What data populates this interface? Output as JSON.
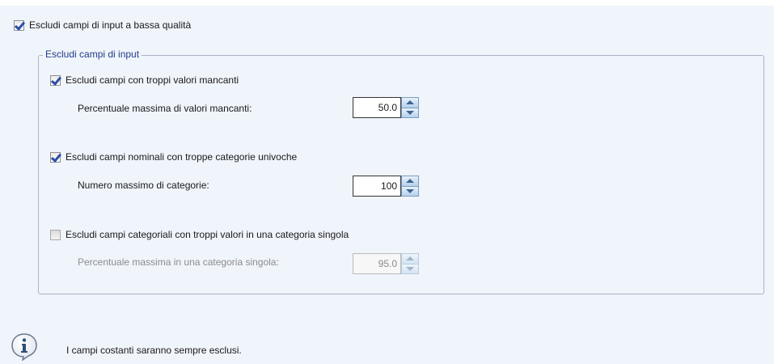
{
  "main_option": {
    "label": "Escludi campi di input a bassa qualità",
    "checked": true
  },
  "group": {
    "legend": "Escludi campi di input",
    "missing": {
      "label": "Escludi campi con troppi valori mancanti",
      "checked": true,
      "field_label": "Percentuale massima di valori mancanti:",
      "value": "50.0"
    },
    "nominal": {
      "label": "Escludi campi nominali con troppe categorie univoche",
      "checked": true,
      "field_label": "Numero massimo di categorie:",
      "value": "100"
    },
    "categorical": {
      "label": "Escludi campi categoriali con troppi valori in una categoria singola",
      "checked": false,
      "field_label": "Percentuale massima in una categoria singola:",
      "value": "95.0",
      "disabled": true
    }
  },
  "info": {
    "icon": "info-icon",
    "text": "I campi costanti saranno sempre esclusi."
  },
  "colors": {
    "panel_bg": "#f0f4fb",
    "legend_text": "#1f3e8a",
    "check_mark": "#2c4ea8",
    "disabled_text": "#8d8d8d"
  }
}
